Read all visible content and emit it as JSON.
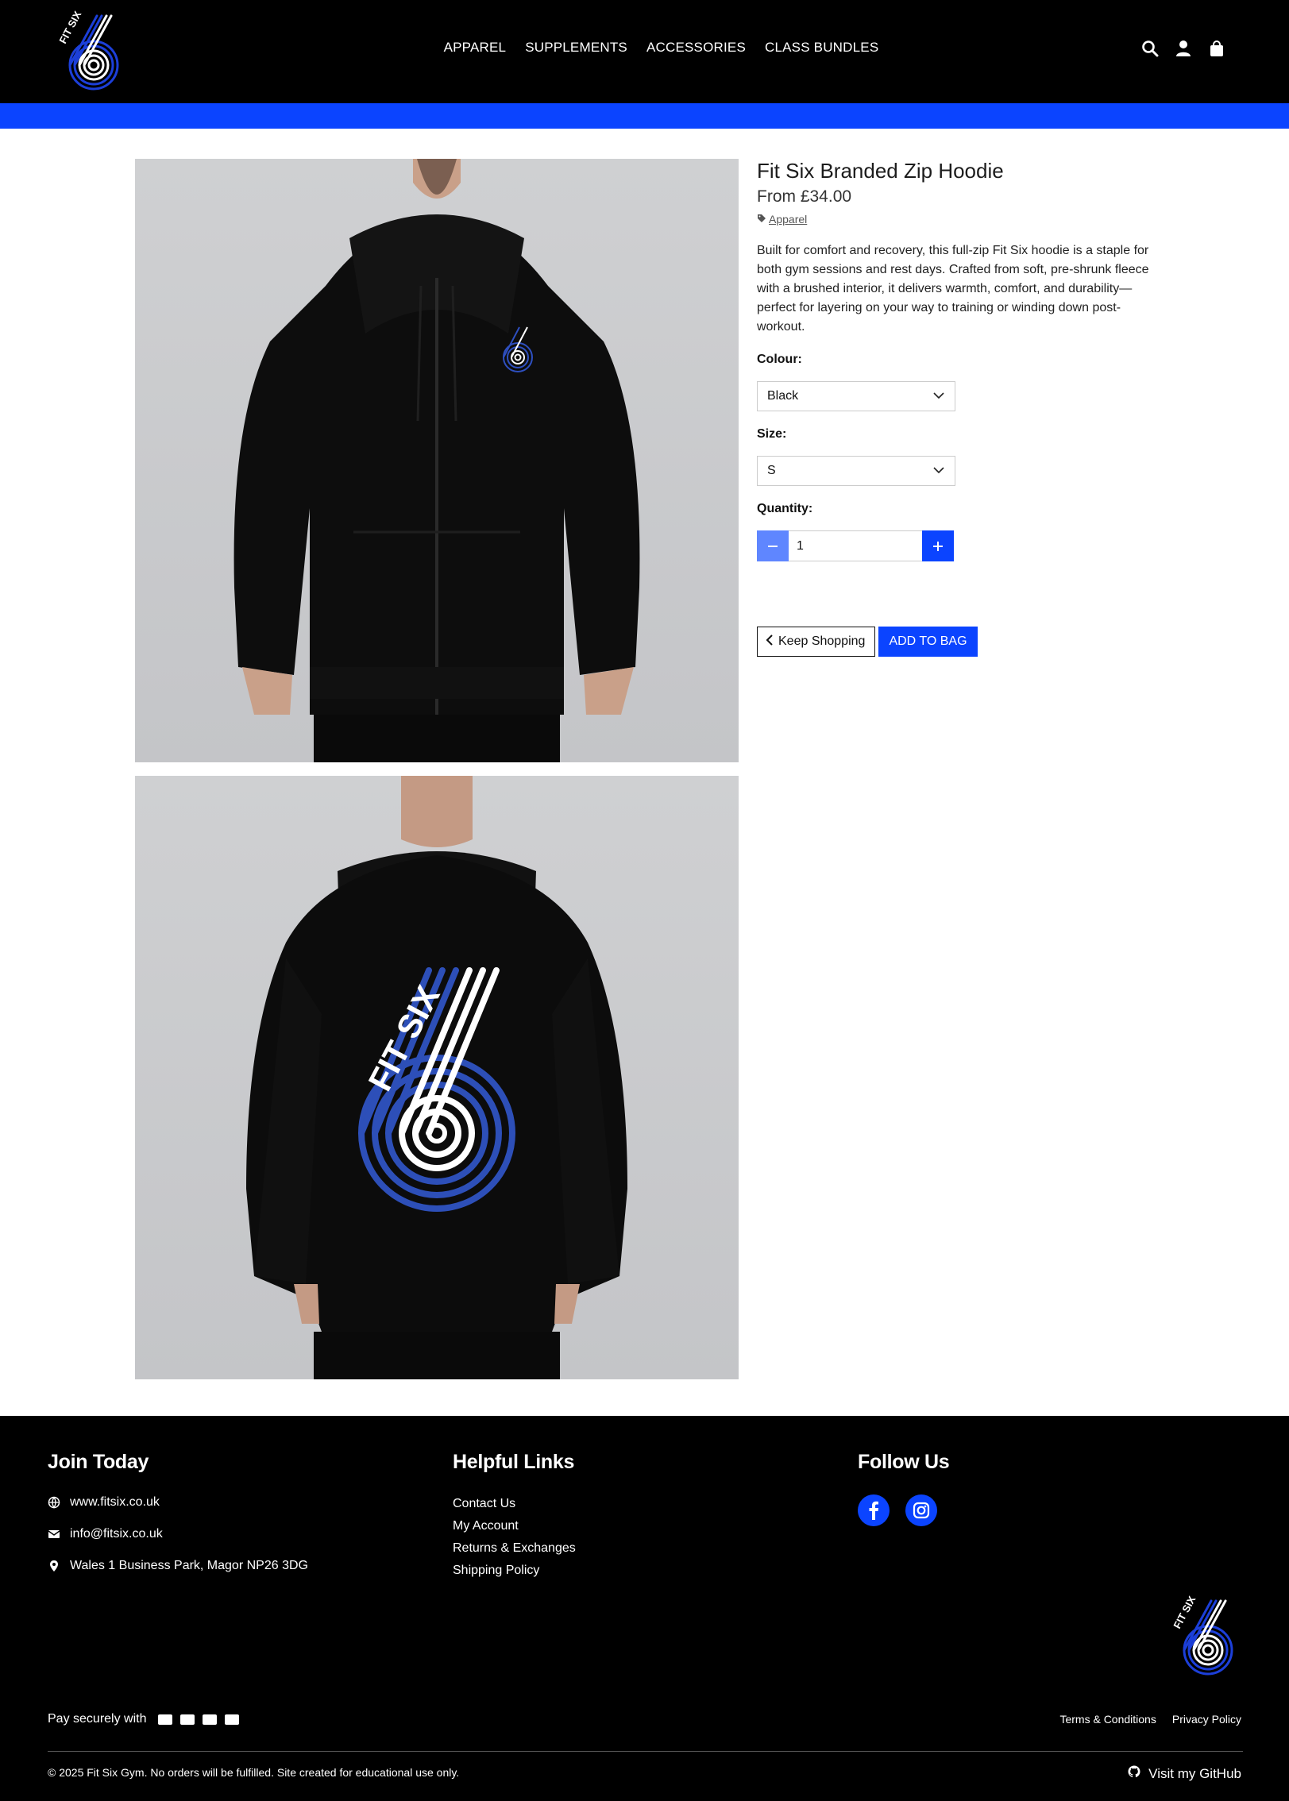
{
  "colors": {
    "accent": "#0b44ff",
    "header_bg": "#000000",
    "footer_bg": "#000000"
  },
  "header": {
    "logo_text": "FIT SIX",
    "nav": [
      "APPAREL",
      "SUPPLEMENTS",
      "ACCESSORIES",
      "CLASS BUNDLES"
    ],
    "icons": [
      "search-icon",
      "user-icon",
      "bag-icon"
    ]
  },
  "product": {
    "images": [
      "hoodie-front-photo",
      "hoodie-back-photo"
    ],
    "title": "Fit Six Branded Zip Hoodie",
    "price": "From £34.00",
    "category": "Apparel",
    "description": "Built for comfort and recovery, this full-zip Fit Six hoodie is a staple for both gym sessions and rest days. Crafted from soft, pre-shrunk fleece with a brushed interior, it delivers warmth, comfort, and durability—perfect for layering on your way to training or winding down post-workout.",
    "colour_label": "Colour:",
    "colour_value": "Black",
    "size_label": "Size:",
    "size_value": "S",
    "quantity_label": "Quantity:",
    "quantity_value": "1",
    "keep_shopping_label": "Keep Shopping",
    "add_to_bag_label": "ADD TO BAG"
  },
  "footer": {
    "join": {
      "heading": "Join Today",
      "website": "www.fitsix.co.uk",
      "email": "info@fitsix.co.uk",
      "address": "Wales 1 Business Park, Magor NP26 3DG"
    },
    "helpful": {
      "heading": "Helpful Links",
      "links": [
        "Contact Us",
        "My Account",
        "Returns & Exchanges",
        "Shipping Policy"
      ]
    },
    "follow": {
      "heading": "Follow Us",
      "icons": [
        "facebook-icon",
        "instagram-icon"
      ]
    },
    "pay_label": "Pay securely with",
    "pay_icons": [
      "visa-icon",
      "mastercard-icon",
      "amex-icon",
      "card-icon"
    ],
    "legal_links": [
      "Terms & Conditions",
      "Privacy Policy"
    ],
    "copyright": "© 2025 Fit Six Gym. No orders will be fulfilled. Site created for educational use only.",
    "github_label": "Visit my GitHub"
  }
}
